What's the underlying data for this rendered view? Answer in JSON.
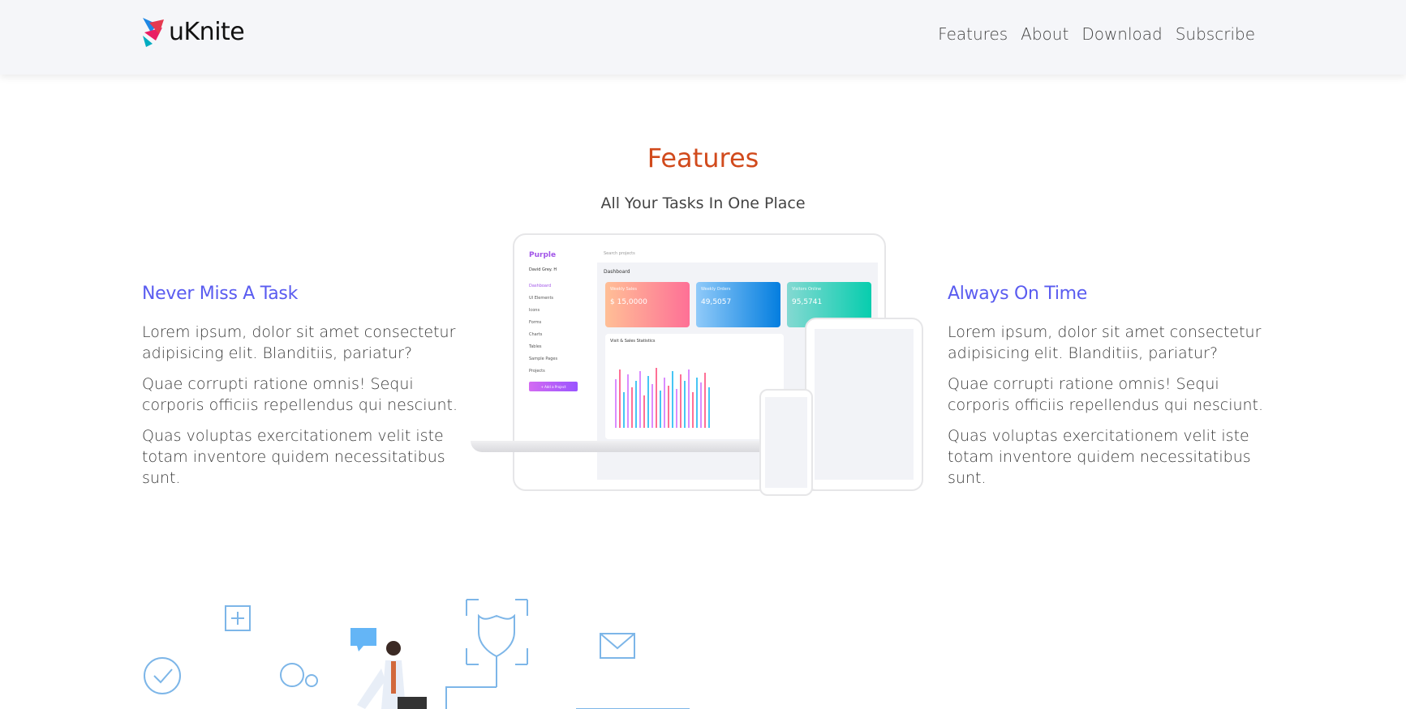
{
  "header": {
    "logo_text": "uKnite",
    "nav": [
      "Features",
      "About",
      "Download",
      "Subscribe"
    ]
  },
  "features": {
    "title": "Features",
    "subtitle": "All Your Tasks In One Place",
    "left": {
      "heading": "Never Miss A Task",
      "paragraphs": [
        "Lorem ipsum, dolor sit amet consectetur adipisicing elit. Blanditiis, pariatur?",
        "Quae corrupti ratione omnis! Sequi corporis officiis repellendus qui nesciunt.",
        "Quas voluptas exercitationem velit iste totam inventore quidem necessitatibus sunt."
      ]
    },
    "right": {
      "heading": "Always On Time",
      "paragraphs": [
        "Lorem ipsum, dolor sit amet consectetur adipisicing elit. Blanditiis, pariatur?",
        "Quae corrupti ratione omnis! Sequi corporis officiis repellendus qui nesciunt.",
        "Quas voluptas exercitationem velit iste totam inventore quidem necessitatibus sunt."
      ]
    }
  },
  "mockup": {
    "brand": "Purple",
    "user": "David Grey. H",
    "search_placeholder": "Search projects",
    "menu": [
      "Dashboard",
      "UI Elements",
      "Icons",
      "Forms",
      "Charts",
      "Tables",
      "Sample Pages"
    ],
    "projects_label": "Projects",
    "add_project": "+ Add a Project",
    "page_title": "Dashboard",
    "cards": [
      {
        "label": "Weekly Sales",
        "value": "$ 15,0000"
      },
      {
        "label": "Weekly Orders",
        "value": "49,5057"
      },
      {
        "label": "Visitors Online",
        "value": "95,5741"
      }
    ],
    "chart_title": "Visit & Sales Statistics"
  },
  "colors": {
    "title": "#d14a1c",
    "heading": "#5a5cf0"
  }
}
